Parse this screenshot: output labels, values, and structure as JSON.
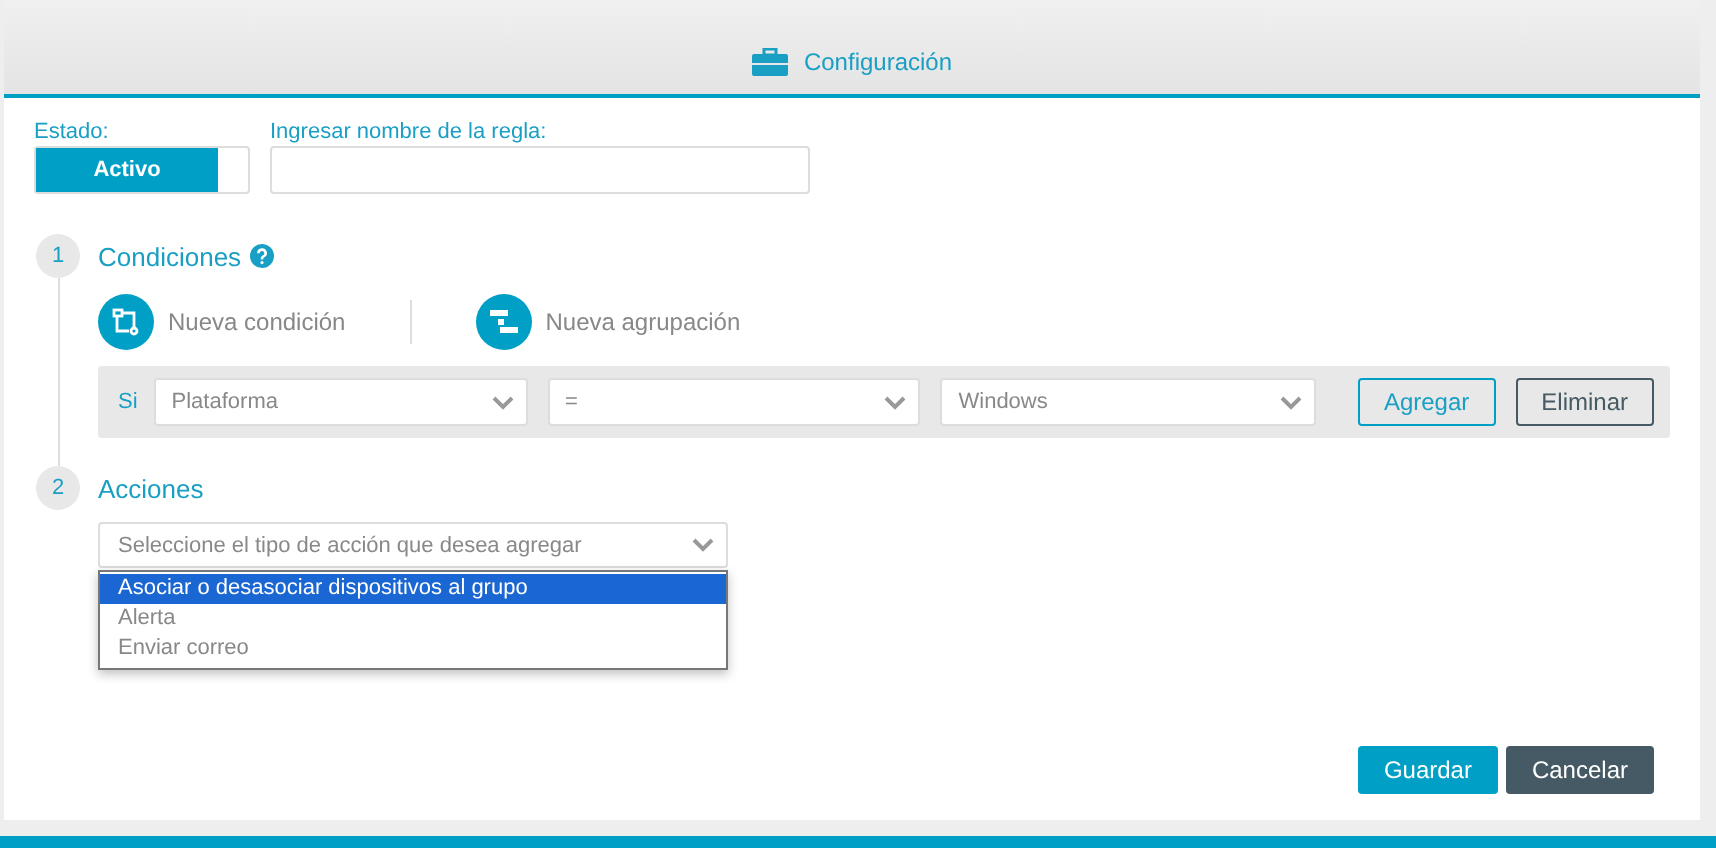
{
  "header": {
    "title": "Configuración"
  },
  "status": {
    "label": "Estado:",
    "value": "Activo",
    "on": true
  },
  "rule_name": {
    "label": "Ingresar nombre de la regla:"
  },
  "steps": [
    {
      "number": "1",
      "title": "Condiciones"
    },
    {
      "number": "2",
      "title": "Acciones"
    }
  ],
  "condition_tools": [
    {
      "label": "Nueva condición",
      "kind": "condition"
    },
    {
      "label": "Nueva agrupación",
      "kind": "group"
    }
  ],
  "condition": {
    "prefix": "Si",
    "selects": [
      "Plataforma",
      "=",
      "Windows"
    ],
    "add": "Agregar",
    "remove": "Eliminar"
  },
  "action_select": {
    "placeholder": "Seleccione el tipo de acción que desea agregar",
    "options": [
      {
        "label": "Asociar o desasociar dispositivos al grupo",
        "selected": true
      },
      {
        "label": "Alerta",
        "selected": false
      },
      {
        "label": "Enviar correo",
        "selected": false
      }
    ]
  },
  "buttons": {
    "save": "Guardar",
    "cancel": "Cancelar"
  }
}
